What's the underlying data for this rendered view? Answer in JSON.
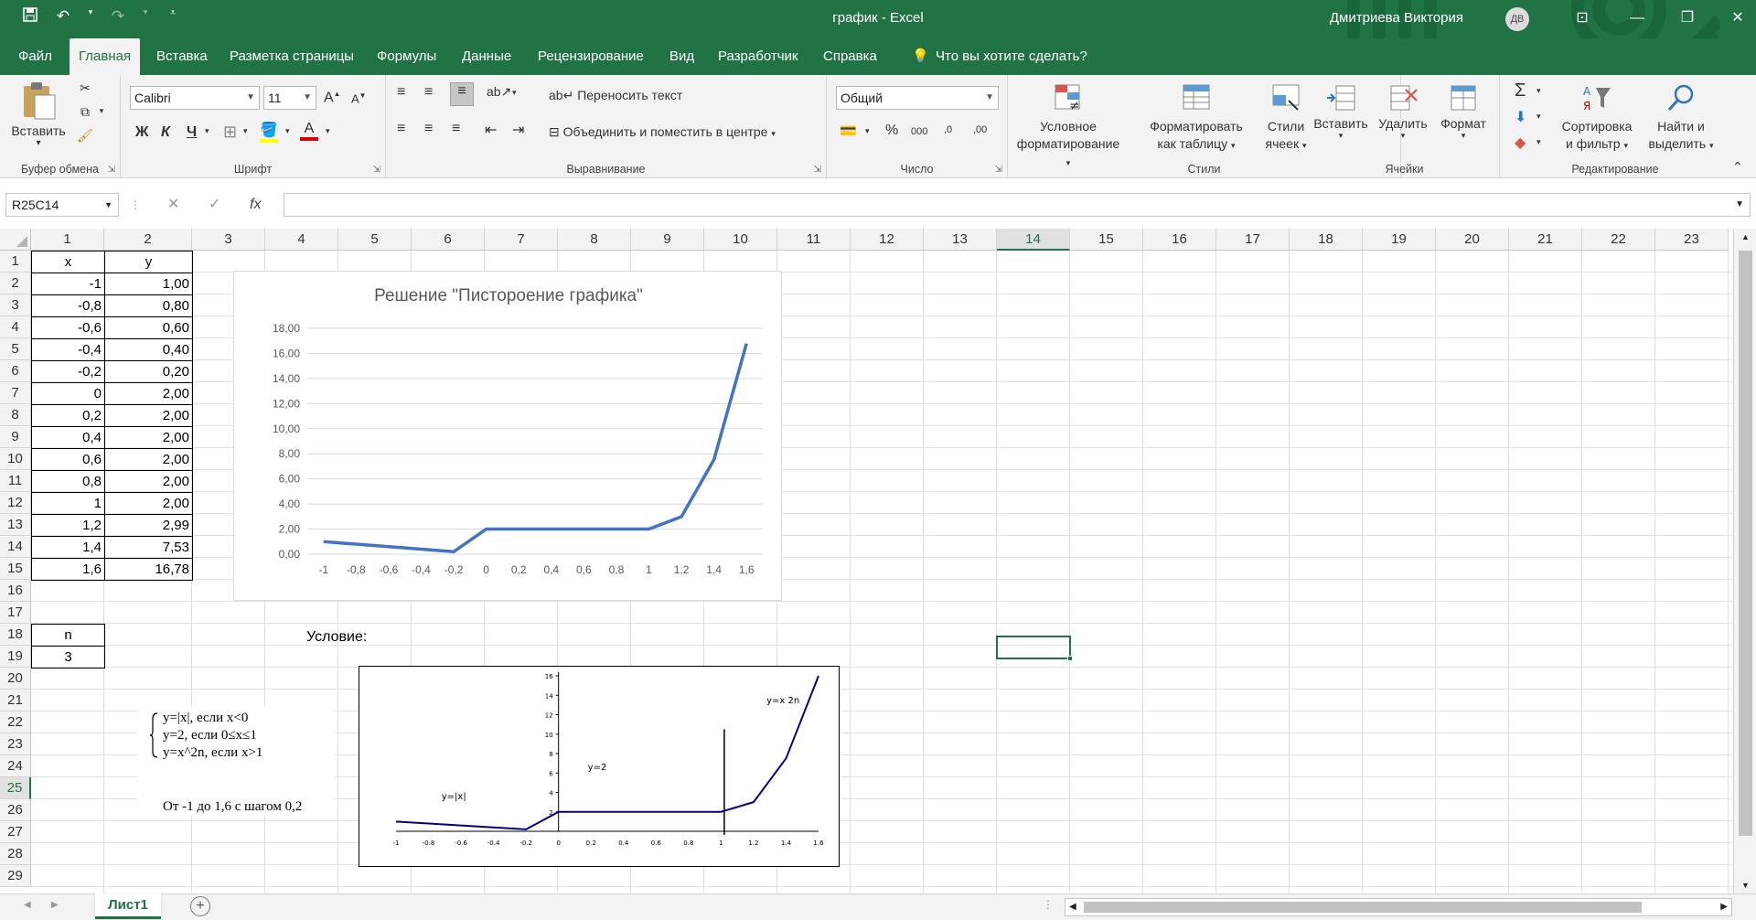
{
  "titlebar": {
    "title": "график  -  Excel",
    "user": "Дмитриева Виктория",
    "avatar_initials": "ДВ",
    "save_icon": "save-icon",
    "undo_icon": "undo-icon",
    "redo_icon": "redo-icon",
    "customize_icon": "customize-qat-icon",
    "minimize": "—",
    "restore": "❐",
    "close": "✕",
    "ribbon_options": "⊡"
  },
  "tabs": [
    "Файл",
    "Главная",
    "Вставка",
    "Разметка страницы",
    "Формулы",
    "Данные",
    "Рецензирование",
    "Вид",
    "Разработчик",
    "Справка",
    "Что вы хотите сделать?"
  ],
  "ribbon": {
    "clipboard": {
      "label": "Буфер обмена",
      "paste": "Вставить"
    },
    "font": {
      "label": "Шрифт",
      "name": "Calibri",
      "size": "11",
      "bold": "Ж",
      "italic": "К",
      "underline": "Ч",
      "grow": "A",
      "shrink": "A"
    },
    "alignment": {
      "label": "Выравнивание",
      "wrap": "Переносить текст",
      "merge": "Объединить и поместить в центре"
    },
    "number": {
      "label": "Число",
      "format": "Общий",
      "percent": "%",
      "thousands": "000",
      "inc": ",0",
      "dec": ",00"
    },
    "styles": {
      "label": "Стили",
      "conditional": "Условное",
      "conditional2": "форматирование",
      "format_table": "Форматировать",
      "format_table2": "как таблицу",
      "cell_styles": "Стили",
      "cell_styles2": "ячеек"
    },
    "cells": {
      "label": "Ячейки",
      "insert": "Вставить",
      "delete": "Удалить",
      "format": "Формат"
    },
    "editing": {
      "label": "Редактирование",
      "sort": "Сортировка",
      "sort2": "и фильтр",
      "find": "Найти и",
      "find2": "выделить"
    }
  },
  "formula_bar": {
    "name_box": "R25C14",
    "cancel": "✕",
    "enter": "✓",
    "fx": "fx",
    "value": ""
  },
  "columns": [
    "1",
    "2",
    "3",
    "4",
    "5",
    "6",
    "7",
    "8",
    "9",
    "10",
    "11",
    "12",
    "13",
    "14",
    "15",
    "16",
    "17",
    "18",
    "19",
    "20",
    "21",
    "22",
    "23"
  ],
  "rows": [
    "1",
    "2",
    "3",
    "4",
    "5",
    "6",
    "7",
    "8",
    "9",
    "10",
    "11",
    "12",
    "13",
    "14",
    "15",
    "16",
    "17",
    "18",
    "19",
    "20",
    "21",
    "22",
    "23",
    "24",
    "25",
    "26",
    "27",
    "28",
    "29"
  ],
  "table": {
    "header_x": "x",
    "header_y": "y",
    "x": [
      "-1",
      "-0,8",
      "-0,6",
      "-0,4",
      "-0,2",
      "0",
      "0,2",
      "0,4",
      "0,6",
      "0,8",
      "1",
      "1,2",
      "1,4",
      "1,6"
    ],
    "y": [
      "1,00",
      "0,80",
      "0,60",
      "0,40",
      "0,20",
      "2,00",
      "2,00",
      "2,00",
      "2,00",
      "2,00",
      "2,00",
      "2,99",
      "7,53",
      "16,78"
    ]
  },
  "n_label": "n",
  "n_value": "3",
  "condition_label": "Условие:",
  "formula_lines": [
    "y=|x|, если x<0",
    "y=2, если 0≤x≤1",
    "y=x^2n, если x>1"
  ],
  "range_text": "От -1 до 1,6 с шагом 0,2",
  "selected_cell": "R25C14",
  "sheet_tab": "Лист1",
  "colors": {
    "accent": "#217346",
    "series": "#4472c4",
    "cond_series": "#000080"
  },
  "chart_data": [
    {
      "type": "line",
      "title": "Решение \"Пистороение графика\"",
      "categories": [
        "-1",
        "-0,8",
        "-0,6",
        "-0,4",
        "-0,2",
        "0",
        "0,2",
        "0,4",
        "0,6",
        "0,8",
        "1",
        "1,2",
        "1,4",
        "1,6"
      ],
      "series": [
        {
          "values": [
            1.0,
            0.8,
            0.6,
            0.4,
            0.2,
            2.0,
            2.0,
            2.0,
            2.0,
            2.0,
            2.0,
            2.99,
            7.53,
            16.78
          ]
        }
      ],
      "ylim": [
        0,
        18
      ],
      "yticks": [
        "0,00",
        "2,00",
        "4,00",
        "6,00",
        "8,00",
        "10,00",
        "12,00",
        "14,00",
        "16,00",
        "18,00"
      ],
      "grid": true
    },
    {
      "type": "line",
      "x": [
        -1,
        -0.8,
        -0.6,
        -0.4,
        -0.2,
        0,
        0.2,
        0.4,
        0.6,
        0.8,
        1,
        1.2,
        1.4,
        1.6
      ],
      "xticks": [
        "-1",
        "-0.8",
        "-0.6",
        "-0.4",
        "-0.2",
        "0",
        "0.2",
        "0.4",
        "0.6",
        "0.8",
        "1",
        "1.2",
        "1.4",
        "1.6"
      ],
      "series": [
        {
          "values": [
            1,
            0.8,
            0.6,
            0.4,
            0.2,
            2,
            2,
            2,
            2,
            2,
            2,
            3,
            7.5,
            16
          ]
        }
      ],
      "ylim": [
        0,
        16
      ],
      "yticks": [
        "2",
        "4",
        "6",
        "8",
        "10",
        "12",
        "14",
        "16"
      ],
      "annotations": [
        "y=|x|",
        "y=2",
        "y=x 2n"
      ]
    }
  ]
}
